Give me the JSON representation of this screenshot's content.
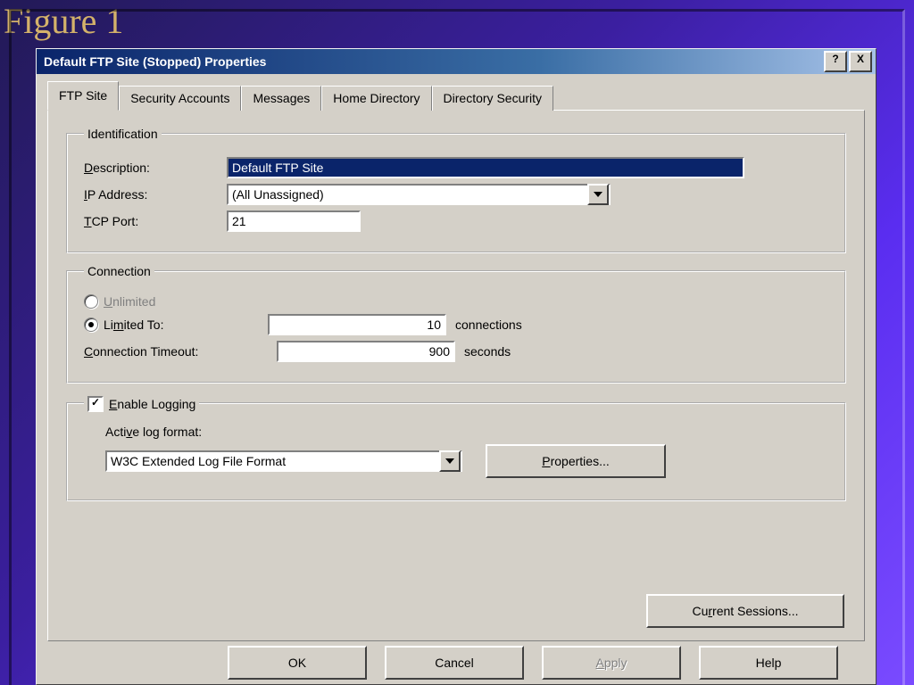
{
  "slide": {
    "figure_label": "Figure 1"
  },
  "window": {
    "title": "Default FTP Site (Stopped) Properties",
    "help_glyph": "?",
    "close_glyph": "X"
  },
  "tabs": {
    "ftp_site": "FTP Site",
    "security": "Security Accounts",
    "messages": "Messages",
    "home_dir": "Home Directory",
    "dir_security": "Directory Security"
  },
  "identification": {
    "legend": "Identification",
    "description_label_pre": "D",
    "description_label_post": "escription:",
    "description_value": "Default FTP Site",
    "ip_label_pre": "I",
    "ip_label_post": "P Address:",
    "ip_value": "(All Unassigned)",
    "tcp_label_pre": "T",
    "tcp_label_post": "CP Port:",
    "tcp_value": "21"
  },
  "connection": {
    "legend": "Connection",
    "unlimited_pre": "U",
    "unlimited_post": "nlimited",
    "limited_pre": "Li",
    "limited_mid_underline": "m",
    "limited_post": "ited To:",
    "limited_value": "10",
    "connections_suffix": "connections",
    "timeout_label_pre": "C",
    "timeout_label_post": "onnection Timeout:",
    "timeout_value": "900",
    "seconds_suffix": "seconds"
  },
  "logging": {
    "enable_pre": "E",
    "enable_post": "nable Logging",
    "format_label_pre": "Acti",
    "format_label_underline": "v",
    "format_label_post": "e log format:",
    "format_value": "W3C Extended Log File Format",
    "properties_btn_pre": "P",
    "properties_btn_post": "roperties..."
  },
  "panel_buttons": {
    "current_sessions_pre": "Cu",
    "current_sessions_underline": "r",
    "current_sessions_post": "rent Sessions..."
  },
  "dialog_buttons": {
    "ok": "OK",
    "cancel": "Cancel",
    "apply_pre": "A",
    "apply_post": "pply",
    "help": "Help"
  }
}
